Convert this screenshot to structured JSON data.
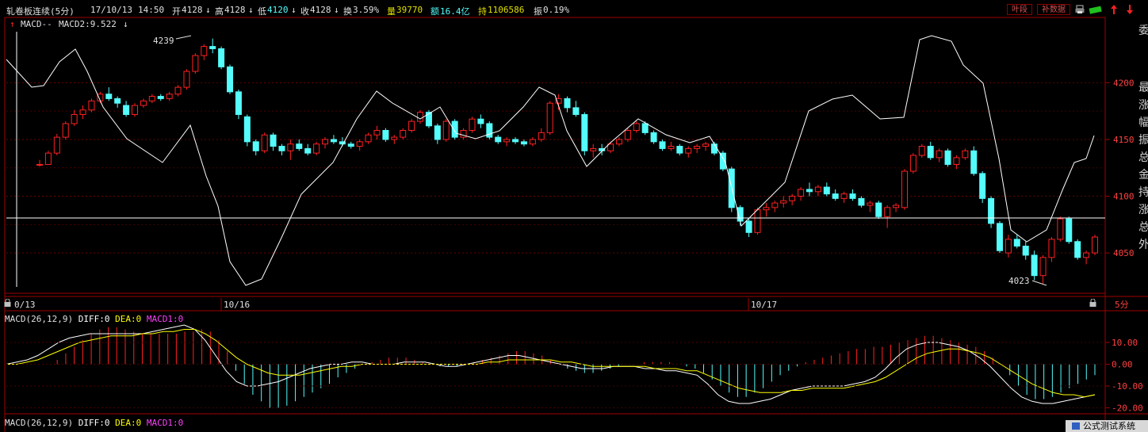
{
  "header": {
    "symbol": "轧卷板连续(5分)",
    "date": "17/10/13",
    "time": "14:50",
    "open_label": "开",
    "open": "4128",
    "high_label": "高",
    "high": "4128",
    "low_label": "低",
    "low": "4120",
    "close_label": "收",
    "close": "4128",
    "turnover_label": "换",
    "turnover": "3.59%",
    "volume_label": "量",
    "volume": "39770",
    "amount_label": "额",
    "amount": "16.4亿",
    "hold_label": "持",
    "hold": "1106586",
    "amplitude_label": "振",
    "amplitude": "0.19%",
    "arrow_down": "↓"
  },
  "toolbar": {
    "period_button": "叶段",
    "fill_data_button": "补数据"
  },
  "indicator_line": {
    "prefix": "MACD--",
    "value": "MACD2:9.522"
  },
  "price_axis": {
    "ticks": [
      "4200",
      "4150",
      "4100",
      "4050"
    ]
  },
  "price_annotations": {
    "high_label": "4239",
    "low_label": "4023"
  },
  "date_axis": {
    "labels": [
      "0/13",
      "10/16",
      "10/17"
    ],
    "period": "5分"
  },
  "lower_panel": {
    "title": "MACD(26,12,9)",
    "diff": "DIFF:0",
    "dea": "DEA:0",
    "macd1": "MACD1:0",
    "ticks": [
      "10.00",
      "0.00",
      "-10.00",
      "-20.00"
    ]
  },
  "bottom_panel": {
    "title": "MACD(26,12,9)",
    "diff": "DIFF:0",
    "dea": "DEA:0",
    "macd1": "MACD1:0"
  },
  "side_panel": {
    "chars": [
      "委",
      "最",
      "涨",
      "幅",
      "振",
      "总",
      "金",
      "持",
      "涨",
      "总",
      "外"
    ]
  },
  "bottom_tab": {
    "label": "公式测试系统"
  },
  "colors": {
    "up": "#ff2020",
    "down": "#54fcfc",
    "frame": "#a00000",
    "diff": "#ffffff",
    "dea": "#ffff00",
    "macd1": "#ff40ff"
  },
  "chart_data": [
    {
      "type": "candlestick",
      "title": "轧卷板连续(5分)",
      "y_ticks": [
        4200,
        4150,
        4100,
        4050
      ],
      "ylim": [
        4020,
        4245
      ],
      "x_labels": [
        "10/13",
        "10/16",
        "10/17"
      ],
      "ohlc_approx": [
        [
          4128,
          4132,
          4126,
          4128
        ],
        [
          4128,
          4140,
          4128,
          4138
        ],
        [
          4138,
          4155,
          4136,
          4152
        ],
        [
          4152,
          4166,
          4150,
          4164
        ],
        [
          4164,
          4176,
          4162,
          4172
        ],
        [
          4172,
          4180,
          4168,
          4176
        ],
        [
          4176,
          4186,
          4174,
          4184
        ],
        [
          4184,
          4192,
          4182,
          4190
        ],
        [
          4190,
          4196,
          4184,
          4186
        ],
        [
          4186,
          4188,
          4178,
          4182
        ],
        [
          4180,
          4184,
          4170,
          4172
        ],
        [
          4172,
          4182,
          4170,
          4180
        ],
        [
          4180,
          4186,
          4178,
          4184
        ],
        [
          4184,
          4190,
          4182,
          4188
        ],
        [
          4188,
          4190,
          4184,
          4186
        ],
        [
          4186,
          4192,
          4184,
          4190
        ],
        [
          4190,
          4198,
          4188,
          4196
        ],
        [
          4196,
          4212,
          4194,
          4210
        ],
        [
          4210,
          4226,
          4208,
          4224
        ],
        [
          4224,
          4234,
          4220,
          4232
        ],
        [
          4232,
          4239,
          4226,
          4230
        ],
        [
          4230,
          4232,
          4212,
          4214
        ],
        [
          4214,
          4216,
          4190,
          4192
        ],
        [
          4192,
          4194,
          4168,
          4172
        ],
        [
          4170,
          4172,
          4144,
          4148
        ],
        [
          4148,
          4150,
          4136,
          4140
        ],
        [
          4140,
          4156,
          4138,
          4154
        ],
        [
          4154,
          4156,
          4140,
          4144
        ],
        [
          4144,
          4146,
          4136,
          4140
        ],
        [
          4140,
          4150,
          4132,
          4146
        ],
        [
          4146,
          4150,
          4140,
          4142
        ],
        [
          4142,
          4146,
          4136,
          4138
        ],
        [
          4138,
          4148,
          4136,
          4146
        ],
        [
          4146,
          4152,
          4142,
          4150
        ],
        [
          4150,
          4154,
          4146,
          4148
        ],
        [
          4148,
          4152,
          4144,
          4146
        ],
        [
          4146,
          4148,
          4142,
          4144
        ],
        [
          4144,
          4150,
          4140,
          4148
        ],
        [
          4148,
          4156,
          4146,
          4154
        ],
        [
          4154,
          4162,
          4150,
          4158
        ],
        [
          4158,
          4160,
          4148,
          4150
        ],
        [
          4150,
          4154,
          4146,
          4152
        ],
        [
          4152,
          4160,
          4150,
          4158
        ],
        [
          4158,
          4168,
          4156,
          4166
        ],
        [
          4166,
          4176,
          4164,
          4174
        ],
        [
          4174,
          4176,
          4160,
          4162
        ],
        [
          4162,
          4164,
          4146,
          4150
        ],
        [
          4150,
          4168,
          4148,
          4166
        ],
        [
          4166,
          4168,
          4150,
          4152
        ],
        [
          4152,
          4160,
          4150,
          4158
        ],
        [
          4158,
          4170,
          4156,
          4168
        ],
        [
          4168,
          4172,
          4160,
          4164
        ],
        [
          4164,
          4166,
          4150,
          4152
        ],
        [
          4152,
          4154,
          4146,
          4148
        ],
        [
          4148,
          4152,
          4144,
          4150
        ],
        [
          4150,
          4152,
          4146,
          4148
        ],
        [
          4148,
          4150,
          4144,
          4146
        ],
        [
          4146,
          4152,
          4144,
          4150
        ],
        [
          4150,
          4160,
          4148,
          4156
        ],
        [
          4156,
          4184,
          4154,
          4182
        ],
        [
          4182,
          4190,
          4176,
          4186
        ],
        [
          4186,
          4188,
          4174,
          4178
        ],
        [
          4178,
          4184,
          4170,
          4172
        ],
        [
          4172,
          4174,
          4136,
          4140
        ],
        [
          4140,
          4146,
          4134,
          4142
        ],
        [
          4142,
          4146,
          4136,
          4140
        ],
        [
          4140,
          4148,
          4138,
          4146
        ],
        [
          4146,
          4152,
          4144,
          4150
        ],
        [
          4150,
          4160,
          4148,
          4158
        ],
        [
          4158,
          4166,
          4156,
          4164
        ],
        [
          4164,
          4166,
          4154,
          4156
        ],
        [
          4156,
          4158,
          4146,
          4148
        ],
        [
          4148,
          4150,
          4140,
          4142
        ],
        [
          4142,
          4148,
          4140,
          4144
        ],
        [
          4144,
          4146,
          4136,
          4138
        ],
        [
          4138,
          4144,
          4134,
          4142
        ],
        [
          4142,
          4146,
          4138,
          4144
        ],
        [
          4144,
          4148,
          4140,
          4146
        ],
        [
          4146,
          4148,
          4136,
          4138
        ],
        [
          4138,
          4140,
          4122,
          4124
        ],
        [
          4124,
          4126,
          4086,
          4090
        ],
        [
          4090,
          4092,
          4074,
          4078
        ],
        [
          4078,
          4080,
          4064,
          4068
        ],
        [
          4068,
          4090,
          4066,
          4088
        ],
        [
          4088,
          4094,
          4082,
          4090
        ],
        [
          4090,
          4096,
          4086,
          4094
        ],
        [
          4094,
          4100,
          4090,
          4096
        ],
        [
          4096,
          4102,
          4092,
          4100
        ],
        [
          4100,
          4108,
          4096,
          4106
        ],
        [
          4106,
          4112,
          4100,
          4104
        ],
        [
          4104,
          4110,
          4100,
          4108
        ],
        [
          4108,
          4112,
          4100,
          4102
        ],
        [
          4102,
          4106,
          4096,
          4098
        ],
        [
          4098,
          4104,
          4094,
          4102
        ],
        [
          4102,
          4106,
          4096,
          4098
        ],
        [
          4098,
          4100,
          4090,
          4092
        ],
        [
          4092,
          4096,
          4086,
          4094
        ],
        [
          4094,
          4096,
          4080,
          4082
        ],
        [
          4082,
          4092,
          4072,
          4090
        ],
        [
          4090,
          4094,
          4086,
          4092
        ],
        [
          4090,
          4124,
          4088,
          4122
        ],
        [
          4122,
          4138,
          4120,
          4136
        ],
        [
          4136,
          4146,
          4134,
          4144
        ],
        [
          4144,
          4148,
          4132,
          4134
        ],
        [
          4134,
          4142,
          4130,
          4140
        ],
        [
          4140,
          4142,
          4126,
          4128
        ],
        [
          4128,
          4136,
          4124,
          4134
        ],
        [
          4134,
          4142,
          4132,
          4140
        ],
        [
          4140,
          4144,
          4118,
          4120
        ],
        [
          4120,
          4122,
          4094,
          4098
        ],
        [
          4098,
          4100,
          4072,
          4076
        ],
        [
          4076,
          4078,
          4050,
          4052
        ],
        [
          4050,
          4066,
          4046,
          4062
        ],
        [
          4062,
          4066,
          4054,
          4056
        ],
        [
          4056,
          4060,
          4044,
          4048
        ],
        [
          4048,
          4052,
          4026,
          4030
        ],
        [
          4030,
          4048,
          4023,
          4046
        ],
        [
          4046,
          4064,
          4042,
          4062
        ],
        [
          4062,
          4082,
          4060,
          4080
        ],
        [
          4080,
          4082,
          4058,
          4060
        ],
        [
          4060,
          4062,
          4044,
          4046
        ],
        [
          4046,
          4052,
          4040,
          4050
        ],
        [
          4050,
          4066,
          4048,
          4064
        ]
      ],
      "overlay": {
        "name": "MACD2",
        "value": 9.522
      },
      "annotations": [
        {
          "label": "4239",
          "value": 4239
        },
        {
          "label": "4023",
          "value": 4023
        }
      ]
    },
    {
      "type": "bar",
      "title": "MACD(26,12,9)",
      "y_ticks": [
        10,
        0,
        -10,
        -20
      ],
      "ylim": [
        -22,
        18
      ],
      "series": [
        {
          "name": "MACD1",
          "values": [
            0,
            0,
            0,
            2,
            5,
            8,
            11,
            14,
            16,
            17,
            17,
            16,
            15,
            14,
            14,
            14,
            14,
            14,
            15,
            15,
            16,
            15,
            11,
            6,
            -3,
            -9,
            -14,
            -17,
            -20,
            -20,
            -19,
            -17,
            -15,
            -13,
            -11,
            -9,
            -6,
            -4,
            -2,
            0,
            1,
            2,
            3,
            3,
            3,
            2,
            1,
            0,
            -1,
            -1,
            -1,
            0,
            1,
            2,
            3,
            4,
            5,
            6,
            6,
            5,
            4,
            2,
            0,
            -2,
            -3,
            -4,
            -4,
            -3,
            -2,
            -1,
            0,
            0,
            1,
            1,
            1,
            1,
            0,
            -1,
            -2,
            -4,
            -7,
            -10,
            -13,
            -15,
            -15,
            -13,
            -11,
            -8,
            -5,
            -3,
            -1,
            1,
            2,
            3,
            4,
            5,
            6,
            7,
            7,
            8,
            8,
            9,
            10,
            11,
            12,
            13,
            13,
            12,
            11,
            10,
            9,
            8,
            6,
            3,
            0,
            -5,
            -10,
            -14,
            -16,
            -16,
            -15,
            -13,
            -11,
            -9,
            -7,
            -5
          ]
        },
        {
          "name": "DIFF",
          "values": [
            0,
            1,
            2,
            4,
            7,
            10,
            12,
            13,
            14,
            14,
            14,
            14,
            14,
            14,
            15,
            16,
            17,
            18,
            16,
            11,
            4,
            -3,
            -8,
            -10,
            -10,
            -9,
            -8,
            -6,
            -4,
            -2,
            -1,
            0,
            0,
            1,
            1,
            0,
            0,
            0,
            1,
            1,
            1,
            0,
            -1,
            -1,
            0,
            1,
            2,
            3,
            4,
            4,
            3,
            2,
            1,
            0,
            -1,
            -2,
            -2,
            -2,
            -1,
            -1,
            -1,
            -2,
            -2,
            -3,
            -3,
            -4,
            -5,
            -9,
            -14,
            -17,
            -18,
            -18,
            -17,
            -16,
            -14,
            -12,
            -11,
            -10,
            -10,
            -10,
            -10,
            -9,
            -8,
            -6,
            -2,
            3,
            7,
            9,
            10,
            10,
            9,
            8,
            6,
            3,
            -1,
            -6,
            -11,
            -15,
            -17,
            -18,
            -18,
            -17,
            -16,
            -15,
            -14
          ]
        },
        {
          "name": "DEA",
          "values": [
            0,
            0,
            1,
            2,
            4,
            6,
            8,
            10,
            11,
            12,
            13,
            13,
            13,
            14,
            14,
            15,
            15,
            16,
            16,
            14,
            11,
            7,
            3,
            0,
            -2,
            -4,
            -5,
            -5,
            -5,
            -4,
            -3,
            -2,
            -1,
            -1,
            0,
            0,
            0,
            0,
            0,
            0,
            0,
            0,
            0,
            0,
            0,
            0,
            1,
            1,
            2,
            2,
            2,
            2,
            2,
            1,
            1,
            0,
            -1,
            -1,
            -1,
            -1,
            -1,
            -1,
            -2,
            -2,
            -2,
            -3,
            -3,
            -5,
            -7,
            -9,
            -11,
            -12,
            -13,
            -13,
            -13,
            -12,
            -12,
            -11,
            -11,
            -11,
            -11,
            -10,
            -9,
            -8,
            -6,
            -3,
            0,
            3,
            5,
            6,
            7,
            7,
            6,
            5,
            3,
            0,
            -3,
            -6,
            -9,
            -11,
            -13,
            -14,
            -14,
            -15,
            -14
          ]
        }
      ]
    }
  ]
}
